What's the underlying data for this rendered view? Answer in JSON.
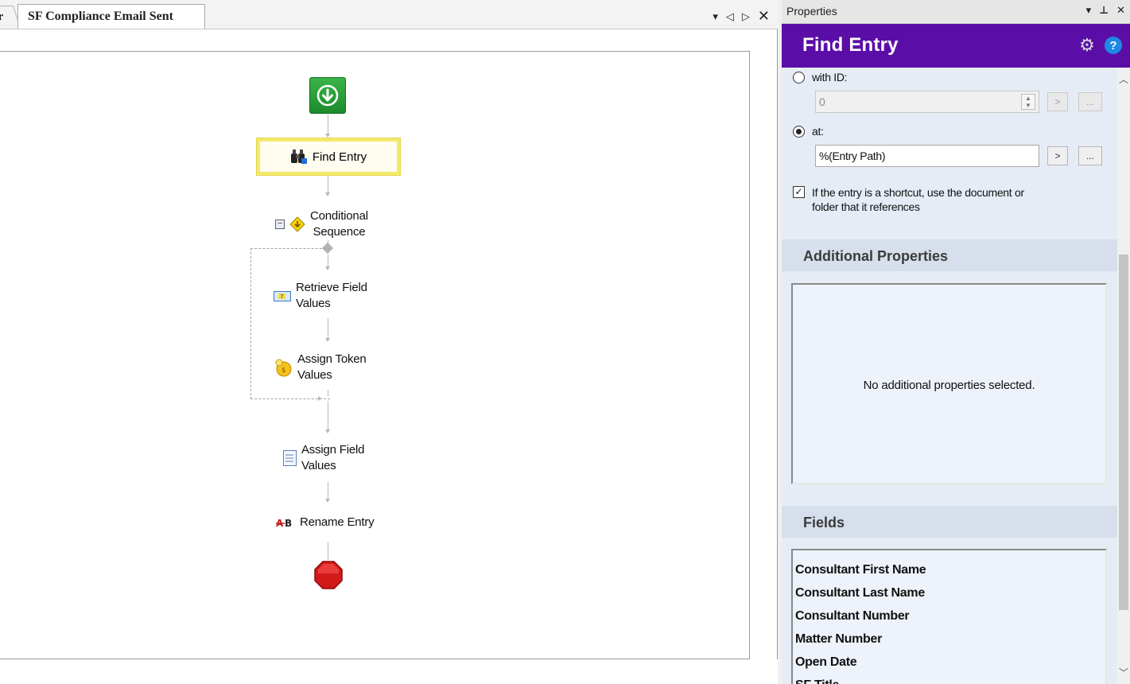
{
  "designer": {
    "prev_tab_label": "r",
    "active_tab_label": "SF Compliance Email Sent",
    "controls": {
      "dropdown": "▾",
      "scroll_left": "◁",
      "scroll_right": "▷",
      "close": "✕"
    }
  },
  "workflow": {
    "nodes": [
      {
        "label": "Find Entry",
        "icon": "binoculars-icon"
      },
      {
        "label": "Conditional\nSequence",
        "icon": "conditional-diamond-icon"
      },
      {
        "label": "Retrieve Field\nValues",
        "icon": "retrieve-fields-icon"
      },
      {
        "label": "Assign Token\nValues",
        "icon": "token-icon"
      },
      {
        "label": "Assign Field\nValues",
        "icon": "form-icon"
      },
      {
        "label": "Rename Entry",
        "icon": "rename-icon"
      }
    ],
    "collapse_glyph": "⊟"
  },
  "properties": {
    "panel_title": "Properties",
    "activity_title": "Find Entry",
    "with_id_label": "with ID:",
    "id_value": "0",
    "at_label": "at:",
    "path_value": "%(Entry Path)",
    "arrow_button": ">",
    "ellipsis_button": "...",
    "shortcut_text": "If the entry is a shortcut, use the document or\nfolder that it references",
    "additional_header": "Additional Properties",
    "additional_empty": "No additional properties selected.",
    "fields_header": "Fields",
    "fields": [
      "Consultant First Name",
      "Consultant Last Name",
      "Consultant Number",
      "Matter Number",
      "Open Date",
      "SF Title"
    ]
  },
  "colors": {
    "header_purple": "#5b0ea7",
    "start_green": "#1b8a2c",
    "end_red": "#d11a1a",
    "selection_yellow": "#f4ea6b"
  }
}
